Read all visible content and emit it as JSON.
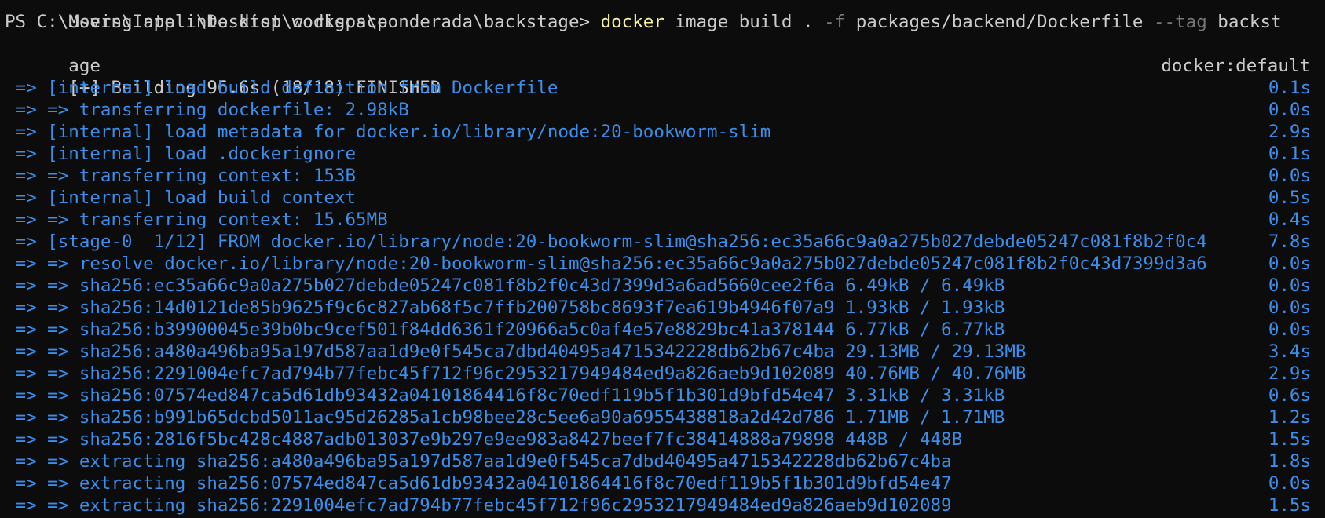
{
  "terminal": {
    "prev_output": "Moving app into dist workspace",
    "prompt": "PS C:\\Users\\Inteli\\Desktop\\codigos\\ponderada\\backstage>",
    "command": {
      "program": "docker",
      "args1": "image build .",
      "flag1": "-f",
      "args2": "packages/backend/Dockerfile",
      "flag2": "--tag",
      "args3": "backst",
      "wrap": "age"
    },
    "build_header": "[+] Building 96.6s (18/18) FINISHED",
    "builder": "docker:default",
    "steps": [
      {
        "text": " => [internal] load build definition from Dockerfile",
        "time": "0.1s"
      },
      {
        "text": " => => transferring dockerfile: 2.98kB",
        "time": "0.0s"
      },
      {
        "text": " => [internal] load metadata for docker.io/library/node:20-bookworm-slim",
        "time": "2.9s"
      },
      {
        "text": " => [internal] load .dockerignore",
        "time": "0.1s"
      },
      {
        "text": " => => transferring context: 153B",
        "time": "0.0s"
      },
      {
        "text": " => [internal] load build context",
        "time": "0.5s"
      },
      {
        "text": " => => transferring context: 15.65MB",
        "time": "0.4s"
      },
      {
        "text": " => [stage-0  1/12] FROM docker.io/library/node:20-bookworm-slim@sha256:ec35a66c9a0a275b027debde05247c081f8b2f0c4",
        "time": "7.8s"
      },
      {
        "text": " => => resolve docker.io/library/node:20-bookworm-slim@sha256:ec35a66c9a0a275b027debde05247c081f8b2f0c43d7399d3a6",
        "time": "0.0s"
      },
      {
        "text": " => => sha256:ec35a66c9a0a275b027debde05247c081f8b2f0c43d7399d3a6ad5660cee2f6a 6.49kB / 6.49kB",
        "time": "0.0s"
      },
      {
        "text": " => => sha256:14d0121de85b9625f9c6c827ab68f5c7ffb200758bc8693f7ea619b4946f07a9 1.93kB / 1.93kB",
        "time": "0.0s"
      },
      {
        "text": " => => sha256:b39900045e39b0bc9cef501f84dd6361f20966a5c0af4e57e8829bc41a378144 6.77kB / 6.77kB",
        "time": "0.0s"
      },
      {
        "text": " => => sha256:a480a496ba95a197d587aa1d9e0f545ca7dbd40495a4715342228db62b67c4ba 29.13MB / 29.13MB",
        "time": "3.4s"
      },
      {
        "text": " => => sha256:2291004efc7ad794b77febc45f712f96c2953217949484ed9a826aeb9d102089 40.76MB / 40.76MB",
        "time": "2.9s"
      },
      {
        "text": " => => sha256:07574ed847ca5d61db93432a04101864416f8c70edf119b5f1b301d9bfd54e47 3.31kB / 3.31kB",
        "time": "0.6s"
      },
      {
        "text": " => => sha256:b991b65dcbd5011ac95d26285a1cb98bee28c5ee6a90a6955438818a2d42d786 1.71MB / 1.71MB",
        "time": "1.2s"
      },
      {
        "text": " => => sha256:2816f5bc428c4887adb013037e9b297e9ee983a8427beef7fc38414888a79898 448B / 448B",
        "time": "1.5s"
      },
      {
        "text": " => => extracting sha256:a480a496ba95a197d587aa1d9e0f545ca7dbd40495a4715342228db62b67c4ba",
        "time": "1.8s"
      },
      {
        "text": " => => extracting sha256:07574ed847ca5d61db93432a04101864416f8c70edf119b5f1b301d9bfd54e47",
        "time": "0.0s"
      },
      {
        "text": " => => extracting sha256:2291004efc7ad794b77febc45f712f96c2953217949484ed9a826aeb9d102089",
        "time": "1.5s"
      }
    ],
    "colors": {
      "background": "#0c0c0c",
      "text": "#cccccc",
      "command": "#f9f1a5",
      "flag": "#767676",
      "step": "#3b8eea"
    }
  }
}
